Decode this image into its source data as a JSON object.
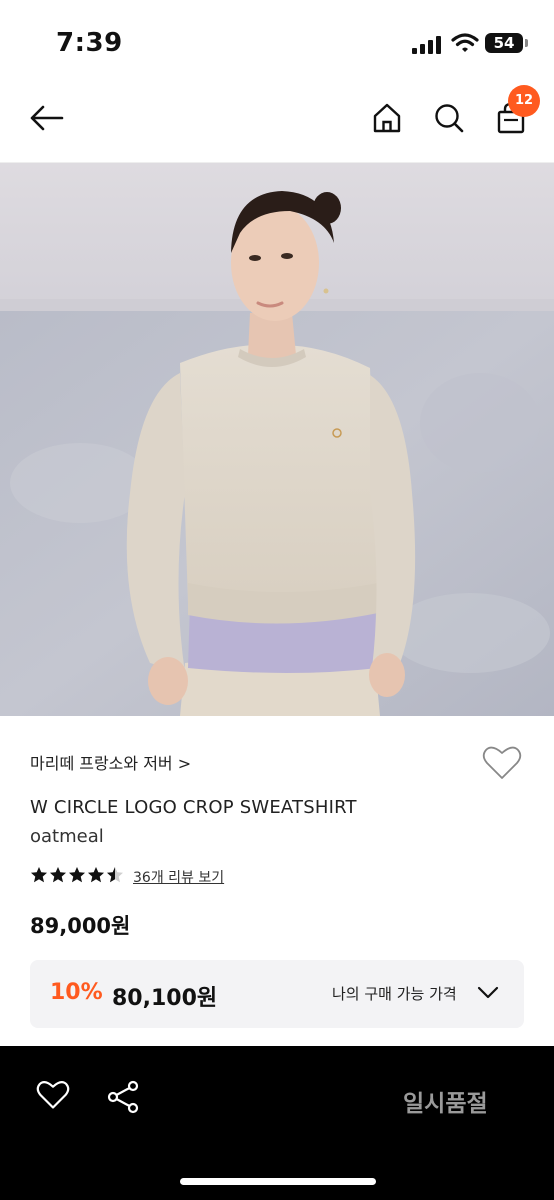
{
  "status_bar": {
    "time": "7:39",
    "battery": "54"
  },
  "nav": {
    "cart_count": "12",
    "icons": [
      "back-arrow-icon",
      "home-icon",
      "search-icon",
      "shopping-bag-icon"
    ]
  },
  "product": {
    "brand": "마리떼 프랑소와 저버 >",
    "name": "W CIRCLE LOGO CROP SWEATSHIRT",
    "color": "oatmeal",
    "rating": 4.5,
    "review_link": "36개 리뷰 보기",
    "price": "89,000원"
  },
  "promo": {
    "discount": "10%",
    "price": "80,100원",
    "label": "나의 구매 가능 가격"
  },
  "bottom_bar": {
    "sold_out": "일시품절"
  },
  "colors": {
    "accent": "#ff5a1f",
    "bar": "#000000",
    "promo_bg": "#f3f3f5"
  }
}
